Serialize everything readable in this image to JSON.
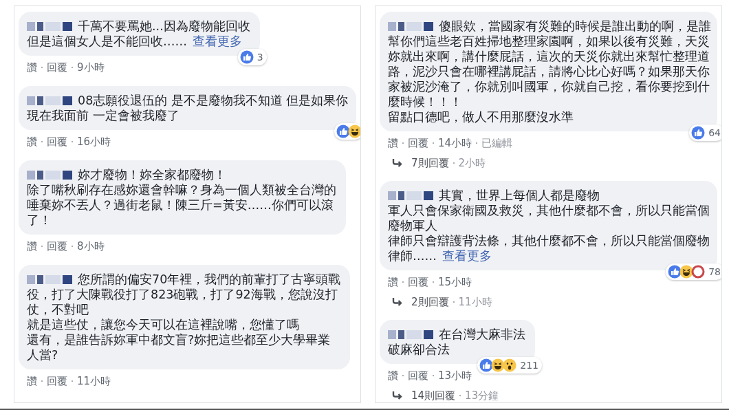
{
  "panels": [
    {
      "comments": [
        {
          "lines": [
            "千萬不要罵她...因為廢物能回收",
            "但是這個女人是不能回收……"
          ],
          "see_more": "查看更多",
          "reactions": {
            "icons": [
              {
                "kind": "like"
              }
            ],
            "count": "3"
          },
          "meta": [
            {
              "text": "讚",
              "kind": "action"
            },
            {
              "text": "回覆",
              "kind": "action"
            },
            {
              "text": "9小時",
              "kind": "time"
            }
          ]
        },
        {
          "lines": [
            "08志願役退伍的 是不是廢物我不知道 但是如果你",
            "現在我面前 一定會被我廢了"
          ],
          "reactions": {
            "icons": [
              {
                "kind": "like"
              },
              {
                "kind": "haha"
              }
            ]
          },
          "meta": [
            {
              "text": "讚",
              "kind": "action"
            },
            {
              "text": "回覆",
              "kind": "action"
            },
            {
              "text": "16小時",
              "kind": "time"
            }
          ]
        },
        {
          "lines": [
            "妳才廢物！妳全家都廢物！",
            "除了嘴秋刷存在感妳還會幹嘛？身為一個人類被全台灣的",
            "唾棄妳不丟人？過街老鼠！陳三斤=黃安……你們可以滾",
            "了！"
          ],
          "meta": [
            {
              "text": "讚",
              "kind": "action"
            },
            {
              "text": "回覆",
              "kind": "action"
            },
            {
              "text": "8小時",
              "kind": "time"
            }
          ]
        },
        {
          "lines": [
            "您所謂的偏安70年裡，我們的前輩打了古寧頭戰",
            "役，打了大陳戰役打了823砲戰，打了92海戰，您說沒打",
            "仗，不對吧",
            "就是這些仗，讓您今天可以在這裡說嘴，您懂了嗎",
            "還有，是誰告訴妳軍中都文盲?妳把這些都至少大學畢業",
            "人當?"
          ],
          "meta": [
            {
              "text": "讚",
              "kind": "action"
            },
            {
              "text": "回覆",
              "kind": "action"
            },
            {
              "text": "11小時",
              "kind": "time"
            }
          ]
        }
      ]
    },
    {
      "comments": [
        {
          "lines": [
            "傻眼欸，當國家有災難的時候是誰出動的啊，是誰",
            "幫你們這些老百姓掃地整理家園啊，如果以後有災難，天災",
            "妳就出來啊，講什麼屁話，這次的天災你就出來幫忙整理道",
            "路，泥沙只會在哪裡講屁話，請將心比心好嗎？如果那天你",
            "家被泥沙淹了，你就別叫國軍，你就自己挖，看你要挖到什",
            "麼時候！！！",
            "留點口德吧，做人不用那麼沒水準"
          ],
          "reactions": {
            "icons": [
              {
                "kind": "like"
              }
            ],
            "count": "64"
          },
          "meta": [
            {
              "text": "讚",
              "kind": "action"
            },
            {
              "text": "回覆",
              "kind": "action"
            },
            {
              "text": "14小時",
              "kind": "time"
            },
            {
              "text": "已編輯",
              "kind": "note"
            }
          ],
          "replies": {
            "count": "7則回覆",
            "time": "2小時"
          }
        },
        {
          "lines": [
            "其實，世界上每個人都是廢物",
            "軍人只會保家衛國及救災，其他什麼都不會，所以只能當個",
            "廢物軍人",
            "律師只會辯護背法條，其他什麼都不會，所以只能當個廢物",
            "律師……"
          ],
          "see_more": "查看更多",
          "reactions": {
            "icons": [
              {
                "kind": "like"
              },
              {
                "kind": "haha"
              },
              {
                "kind": "love"
              }
            ],
            "count": "78"
          },
          "meta": [
            {
              "text": "讚",
              "kind": "action"
            },
            {
              "text": "回覆",
              "kind": "action"
            },
            {
              "text": "15小時",
              "kind": "time"
            }
          ],
          "replies": {
            "count": "2則回覆",
            "time": "11小時"
          }
        },
        {
          "lines": [
            "在台灣大麻非法",
            "破麻卻合法"
          ],
          "reactions": {
            "icons": [
              {
                "kind": "like"
              },
              {
                "kind": "haha"
              },
              {
                "kind": "wow"
              }
            ],
            "count": "211"
          },
          "meta": [
            {
              "text": "讚",
              "kind": "action"
            },
            {
              "text": "回覆",
              "kind": "action"
            },
            {
              "text": "13小時",
              "kind": "time"
            }
          ],
          "replies": {
            "count": "14則回覆",
            "time": "13分鐘"
          }
        }
      ]
    }
  ]
}
